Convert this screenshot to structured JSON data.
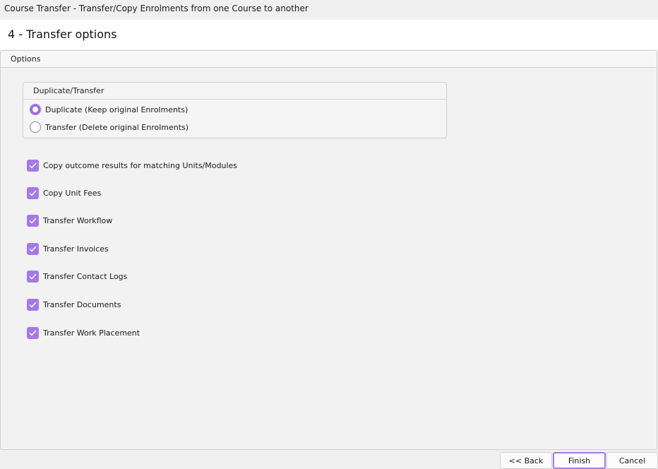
{
  "window": {
    "title": "Course Transfer  - Transfer/Copy Enrolments from one Course to another"
  },
  "header": {
    "step_title": "4 - Transfer options"
  },
  "options_tab": {
    "label": "Options"
  },
  "duplicate_transfer": {
    "group_label": "Duplicate/Transfer",
    "options": [
      {
        "label": "Duplicate (Keep original Enrolments)",
        "selected": true
      },
      {
        "label": "Transfer (Delete original Enrolments)",
        "selected": false
      }
    ]
  },
  "checkboxes": [
    {
      "label": "Copy outcome results for matching Units/Modules",
      "checked": true
    },
    {
      "label": "Copy Unit Fees",
      "checked": true
    },
    {
      "label": "Transfer Workflow",
      "checked": true
    },
    {
      "label": "Transfer Invoices",
      "checked": true
    },
    {
      "label": "Transfer Contact Logs",
      "checked": true
    },
    {
      "label": "Transfer Documents",
      "checked": true
    },
    {
      "label": "Transfer Work Placement",
      "checked": true
    }
  ],
  "footer": {
    "back_label": "<< Back",
    "finish_label": "Finish",
    "cancel_label": "Cancel"
  },
  "colors": {
    "accent": "#a479e6",
    "radio_accent": "#a06ee0"
  }
}
